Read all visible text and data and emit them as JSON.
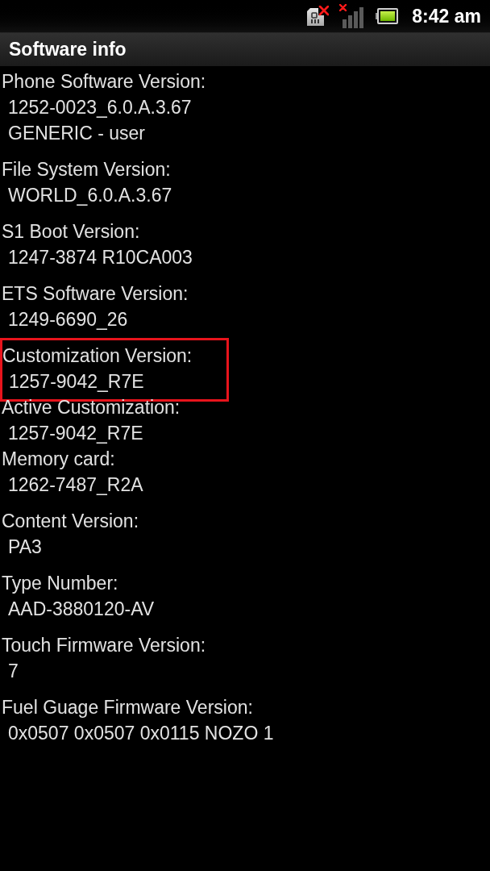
{
  "status_bar": {
    "time": "8:42 am"
  },
  "title_bar": {
    "title": "Software info"
  },
  "groups": [
    {
      "fields": [
        {
          "label": "Phone Software Version:",
          "values": [
            "1252-0023_6.0.A.3.67",
            "GENERIC - user"
          ],
          "highlighted": false
        }
      ]
    },
    {
      "fields": [
        {
          "label": "File System Version:",
          "values": [
            "WORLD_6.0.A.3.67"
          ],
          "highlighted": false
        }
      ]
    },
    {
      "fields": [
        {
          "label": "S1 Boot Version:",
          "values": [
            "1247-3874 R10CA003"
          ],
          "highlighted": false
        }
      ]
    },
    {
      "fields": [
        {
          "label": "ETS Software Version:",
          "values": [
            "1249-6690_26"
          ],
          "highlighted": false
        }
      ]
    },
    {
      "fields": [
        {
          "label": "Customization Version:",
          "values": [
            "1257-9042_R7E"
          ],
          "highlighted": true
        },
        {
          "label": "Active Customization:",
          "values": [
            "1257-9042_R7E"
          ],
          "highlighted": false
        },
        {
          "label": "Memory card:",
          "values": [
            "1262-7487_R2A"
          ],
          "highlighted": false
        }
      ]
    },
    {
      "fields": [
        {
          "label": "Content Version:",
          "values": [
            "PA3"
          ],
          "highlighted": false
        }
      ]
    },
    {
      "fields": [
        {
          "label": "Type Number:",
          "values": [
            "AAD-3880120-AV"
          ],
          "highlighted": false
        }
      ]
    },
    {
      "fields": [
        {
          "label": "Touch Firmware Version:",
          "values": [
            "7"
          ],
          "highlighted": false
        }
      ]
    },
    {
      "fields": [
        {
          "label": "Fuel Guage Firmware Version:",
          "values": [
            "0x0507 0x0507 0x0115 NOZO 1"
          ],
          "highlighted": false
        }
      ]
    }
  ]
}
